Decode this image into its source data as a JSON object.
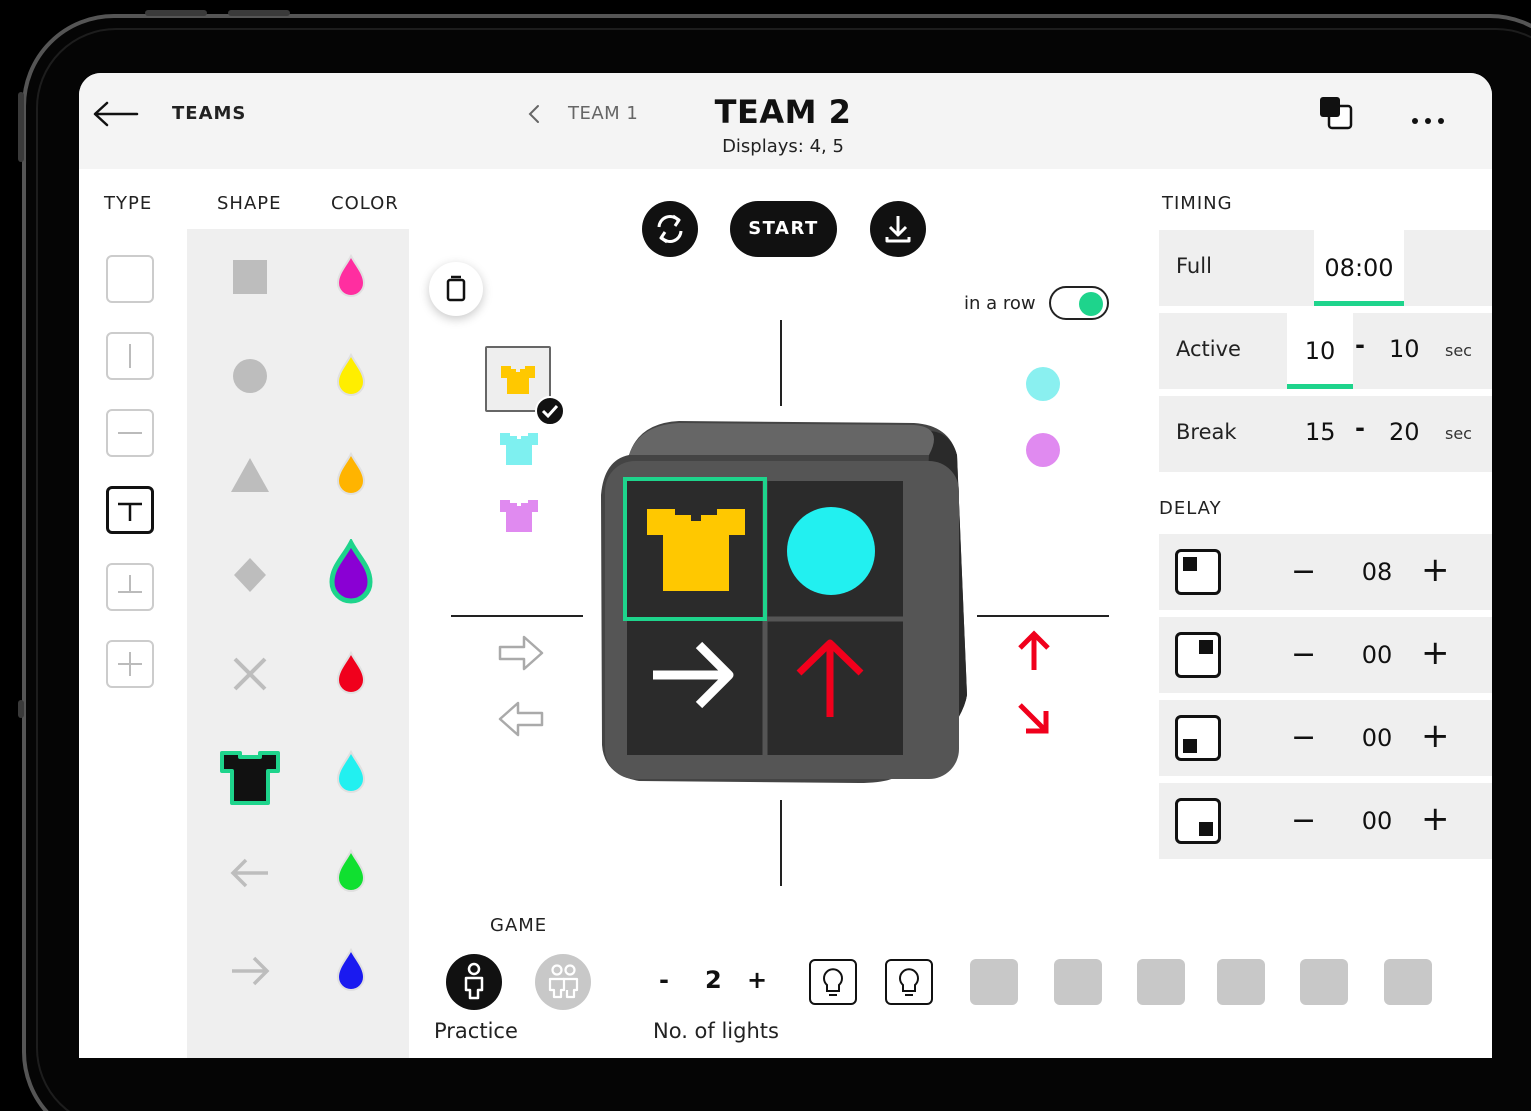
{
  "header": {
    "back_label": "TEAMS",
    "prev_team": "TEAM 1",
    "title": "TEAM 2",
    "subtitle": "Displays: 4, 5"
  },
  "columns": {
    "type": "TYPE",
    "shape": "SHAPE",
    "color": "COLOR"
  },
  "type_options": [
    "blank",
    "vertical-split",
    "horizontal-split",
    "t-split",
    "inverted-t-split",
    "cross-split"
  ],
  "type_selected": "t-split",
  "shapes": [
    "square",
    "circle",
    "triangle",
    "diamond",
    "cross",
    "shirt",
    "arrow-left",
    "arrow-right"
  ],
  "shape_selected": "shirt",
  "colors": [
    "#ff2ea0",
    "#ffee00",
    "#ffb400",
    "#8a00d4",
    "#f0001c",
    "#22f0f0",
    "#10e030",
    "#1a1af0"
  ],
  "color_selected": "#8a00d4",
  "toolbar": {
    "start_label": "START",
    "sync_icon": "sync-icon",
    "download_icon": "download-icon"
  },
  "in_a_row": {
    "label": "in a row",
    "on": true
  },
  "accent_color": "#1ed48c",
  "timing": {
    "label": "TIMING",
    "full_label": "Full",
    "full_value": "08:00",
    "active_label": "Active",
    "active_min": "10",
    "active_max": "10",
    "break_label": "Break",
    "break_min": "15",
    "break_max": "20",
    "dash": "-",
    "unit": "sec"
  },
  "delay": {
    "label": "DELAY",
    "rows": [
      {
        "quadrant": "top-left",
        "value": "08"
      },
      {
        "quadrant": "top-right",
        "value": "00"
      },
      {
        "quadrant": "bottom-left",
        "value": "00"
      },
      {
        "quadrant": "bottom-right",
        "value": "00"
      }
    ],
    "minus": "−",
    "plus": "+"
  },
  "display_preview": {
    "top_left": {
      "shape": "shirt",
      "color": "#ffc800",
      "selected": true
    },
    "top_right": {
      "shape": "circle",
      "color": "#22f0f0"
    },
    "bottom_left": {
      "shape": "arrow-right",
      "color": "#ffffff"
    },
    "bottom_right": {
      "shape": "arrow-up",
      "color": "#f0001c"
    }
  },
  "left_variants": {
    "shirts": [
      "#ffc800",
      "#7ef0f0",
      "#e08af0"
    ],
    "arrows": [
      "arrow-right-outline",
      "arrow-left-outline"
    ]
  },
  "right_variants": {
    "circles": [
      "#8af0f0",
      "#e08af0"
    ],
    "arrows": [
      "arrow-up-red",
      "arrow-down-right-red"
    ]
  },
  "game": {
    "label": "GAME",
    "mode_label": "Practice",
    "modes": [
      "practice",
      "team"
    ],
    "lights_minus": "-",
    "lights_value": "2",
    "lights_plus": "+",
    "lights_label": "No. of lights",
    "slots": [
      true,
      true,
      false,
      false,
      false,
      false,
      false,
      false
    ]
  }
}
